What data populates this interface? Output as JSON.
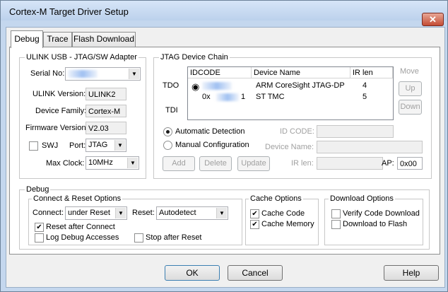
{
  "window": {
    "title": "Cortex-M Target Driver Setup",
    "close_glyph": "✕"
  },
  "tabs": [
    {
      "label": "Debug"
    },
    {
      "label": "Trace"
    },
    {
      "label": "Flash Download"
    }
  ],
  "adapter": {
    "group_label": "ULINK USB - JTAG/SW Adapter",
    "serial_label": "Serial No:",
    "version_label": "ULINK Version:",
    "version_value": "ULINK2",
    "family_label": "Device Family:",
    "family_value": "Cortex-M",
    "firmware_label": "Firmware Version:",
    "firmware_value": "V2.03",
    "swj_label": "SWJ",
    "port_label": "Port:",
    "port_value": "JTAG",
    "clock_label": "Max Clock:",
    "clock_value": "10MHz"
  },
  "chain": {
    "group_label": "JTAG Device Chain",
    "tdo_label": "TDO",
    "tdi_label": "TDI",
    "columns": [
      "IDCODE",
      "Device Name",
      "IR len"
    ],
    "rows": [
      {
        "idcode": "",
        "name": "ARM CoreSight JTAG-DP",
        "irlen": "4"
      },
      {
        "idcode": "0x",
        "idcode_tail": "1",
        "name": "ST TMC",
        "irlen": "5"
      }
    ],
    "move_label": "Move",
    "up_label": "Up",
    "down_label": "Down",
    "auto_label": "Automatic Detection",
    "manual_label": "Manual Configuration",
    "idcode_label": "ID CODE:",
    "devname_label": "Device Name:",
    "irlen_label": "IR len:",
    "ap_label": "AP:",
    "ap_value": "0x00",
    "add_label": "Add",
    "delete_label": "Delete",
    "update_label": "Update"
  },
  "debug": {
    "group_label": "Debug",
    "connect_group": "Connect & Reset Options",
    "connect_label": "Connect:",
    "connect_value": "under Reset",
    "reset_label": "Reset:",
    "reset_value": "Autodetect",
    "reset_after_connect": "Reset after Connect",
    "log_debug": "Log Debug Accesses",
    "stop_after_reset": "Stop after Reset",
    "cache_group": "Cache Options",
    "cache_code": "Cache Code",
    "cache_memory": "Cache Memory",
    "download_group": "Download Options",
    "verify_code": "Verify Code Download",
    "download_flash": "Download to Flash"
  },
  "footer": {
    "ok": "OK",
    "cancel": "Cancel",
    "help": "Help"
  },
  "glyphs": {
    "check": "✔",
    "dropdown": "▼"
  }
}
